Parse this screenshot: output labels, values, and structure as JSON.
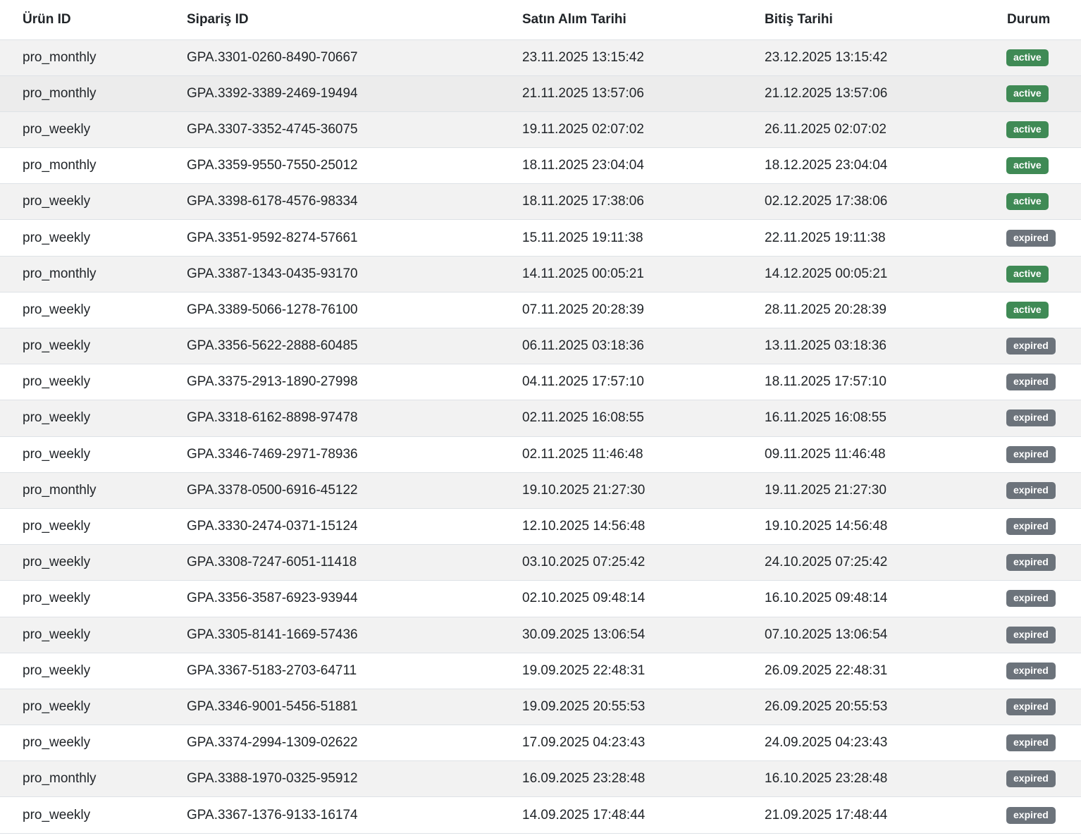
{
  "columns": {
    "product_id": "Ürün ID",
    "order_id": "Sipariş ID",
    "purchase_date": "Satın Alım Tarihi",
    "end_date": "Bitiş Tarihi",
    "status": "Durum"
  },
  "status_colors": {
    "active": "#3f8a55",
    "expired": "#6c737b"
  },
  "rows": [
    {
      "product": "pro_monthly",
      "order": "GPA.3301-0260-8490-70667",
      "purchased": "23.11.2025 13:15:42",
      "ends": "23.12.2025 13:15:42",
      "status": "active"
    },
    {
      "product": "pro_monthly",
      "order": "GPA.3392-3389-2469-19494",
      "purchased": "21.11.2025 13:57:06",
      "ends": "21.12.2025 13:57:06",
      "status": "active"
    },
    {
      "product": "pro_weekly",
      "order": "GPA.3307-3352-4745-36075",
      "purchased": "19.11.2025 02:07:02",
      "ends": "26.11.2025 02:07:02",
      "status": "active"
    },
    {
      "product": "pro_monthly",
      "order": "GPA.3359-9550-7550-25012",
      "purchased": "18.11.2025 23:04:04",
      "ends": "18.12.2025 23:04:04",
      "status": "active"
    },
    {
      "product": "pro_weekly",
      "order": "GPA.3398-6178-4576-98334",
      "purchased": "18.11.2025 17:38:06",
      "ends": "02.12.2025 17:38:06",
      "status": "active"
    },
    {
      "product": "pro_weekly",
      "order": "GPA.3351-9592-8274-57661",
      "purchased": "15.11.2025 19:11:38",
      "ends": "22.11.2025 19:11:38",
      "status": "expired"
    },
    {
      "product": "pro_monthly",
      "order": "GPA.3387-1343-0435-93170",
      "purchased": "14.11.2025 00:05:21",
      "ends": "14.12.2025 00:05:21",
      "status": "active"
    },
    {
      "product": "pro_weekly",
      "order": "GPA.3389-5066-1278-76100",
      "purchased": "07.11.2025 20:28:39",
      "ends": "28.11.2025 20:28:39",
      "status": "active"
    },
    {
      "product": "pro_weekly",
      "order": "GPA.3356-5622-2888-60485",
      "purchased": "06.11.2025 03:18:36",
      "ends": "13.11.2025 03:18:36",
      "status": "expired"
    },
    {
      "product": "pro_weekly",
      "order": "GPA.3375-2913-1890-27998",
      "purchased": "04.11.2025 17:57:10",
      "ends": "18.11.2025 17:57:10",
      "status": "expired"
    },
    {
      "product": "pro_weekly",
      "order": "GPA.3318-6162-8898-97478",
      "purchased": "02.11.2025 16:08:55",
      "ends": "16.11.2025 16:08:55",
      "status": "expired"
    },
    {
      "product": "pro_weekly",
      "order": "GPA.3346-7469-2971-78936",
      "purchased": "02.11.2025 11:46:48",
      "ends": "09.11.2025 11:46:48",
      "status": "expired"
    },
    {
      "product": "pro_monthly",
      "order": "GPA.3378-0500-6916-45122",
      "purchased": "19.10.2025 21:27:30",
      "ends": "19.11.2025 21:27:30",
      "status": "expired"
    },
    {
      "product": "pro_weekly",
      "order": "GPA.3330-2474-0371-15124",
      "purchased": "12.10.2025 14:56:48",
      "ends": "19.10.2025 14:56:48",
      "status": "expired"
    },
    {
      "product": "pro_weekly",
      "order": "GPA.3308-7247-6051-11418",
      "purchased": "03.10.2025 07:25:42",
      "ends": "24.10.2025 07:25:42",
      "status": "expired"
    },
    {
      "product": "pro_weekly",
      "order": "GPA.3356-3587-6923-93944",
      "purchased": "02.10.2025 09:48:14",
      "ends": "16.10.2025 09:48:14",
      "status": "expired"
    },
    {
      "product": "pro_weekly",
      "order": "GPA.3305-8141-1669-57436",
      "purchased": "30.09.2025 13:06:54",
      "ends": "07.10.2025 13:06:54",
      "status": "expired"
    },
    {
      "product": "pro_weekly",
      "order": "GPA.3367-5183-2703-64711",
      "purchased": "19.09.2025 22:48:31",
      "ends": "26.09.2025 22:48:31",
      "status": "expired"
    },
    {
      "product": "pro_weekly",
      "order": "GPA.3346-9001-5456-51881",
      "purchased": "19.09.2025 20:55:53",
      "ends": "26.09.2025 20:55:53",
      "status": "expired"
    },
    {
      "product": "pro_weekly",
      "order": "GPA.3374-2994-1309-02622",
      "purchased": "17.09.2025 04:23:43",
      "ends": "24.09.2025 04:23:43",
      "status": "expired"
    },
    {
      "product": "pro_monthly",
      "order": "GPA.3388-1970-0325-95912",
      "purchased": "16.09.2025 23:28:48",
      "ends": "16.10.2025 23:28:48",
      "status": "expired"
    },
    {
      "product": "pro_weekly",
      "order": "GPA.3367-1376-9133-16174",
      "purchased": "14.09.2025 17:48:44",
      "ends": "21.09.2025 17:48:44",
      "status": "expired"
    }
  ]
}
